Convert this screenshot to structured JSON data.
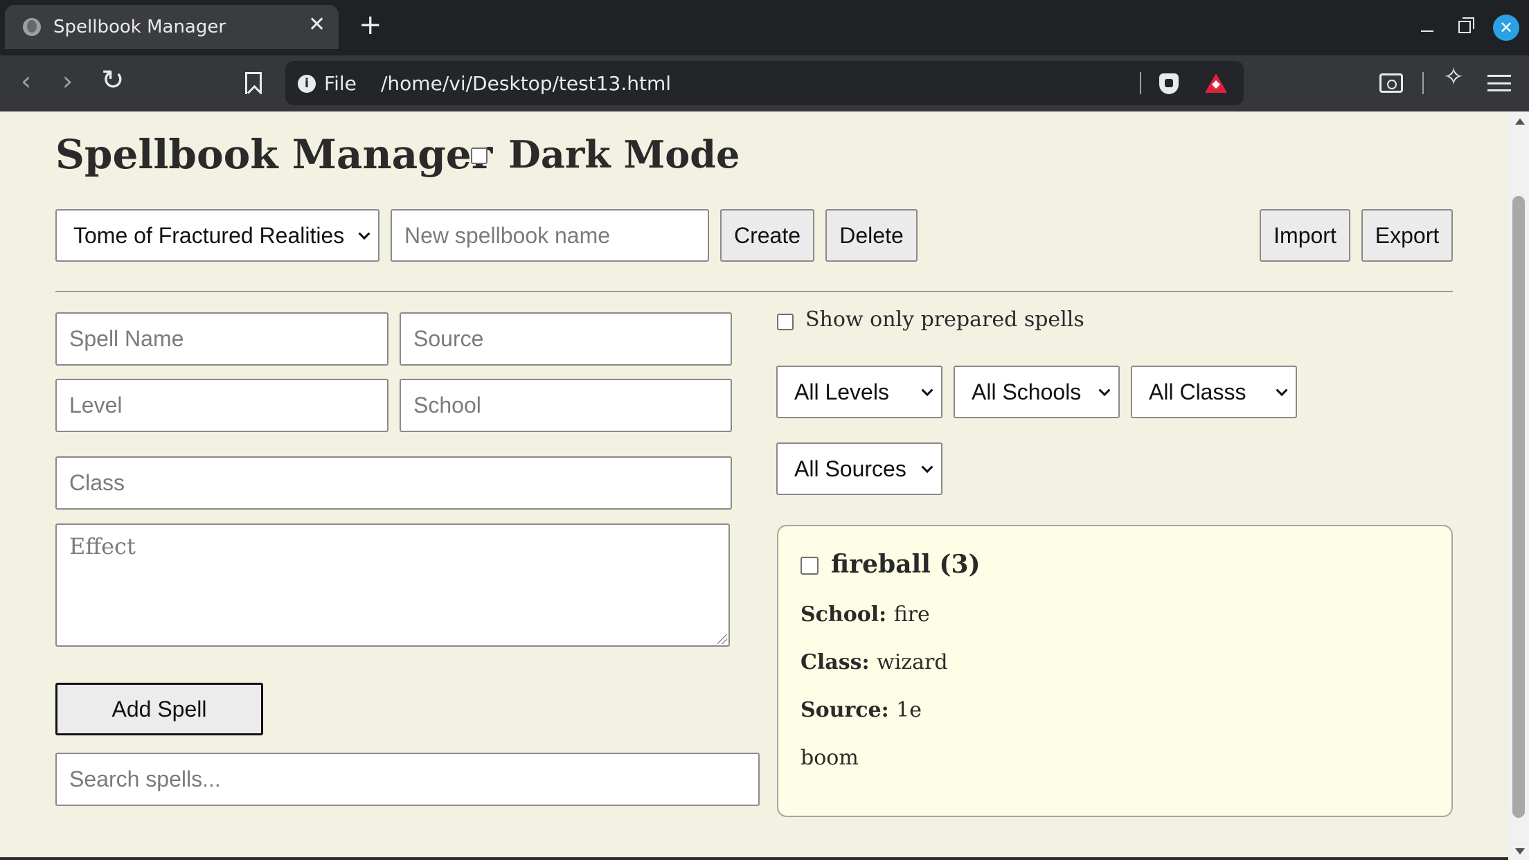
{
  "browser": {
    "tab_title": "Spellbook Manager",
    "tab_close": "✕",
    "new_tab": "+",
    "url_scheme": "File",
    "url_path": "/home/vi/Desktop/test13.html",
    "close_button": "✕",
    "back": "‹",
    "forward": "›",
    "reload": "↻",
    "ai_icon": "✧"
  },
  "app": {
    "title": "Spellbook Manager",
    "dark_mode_label": "Dark Mode",
    "dark_mode_checked": false
  },
  "spellbook_bar": {
    "selected_spellbook": "Tome of Fractured Realities",
    "new_name_placeholder": "New spellbook name",
    "create_label": "Create",
    "delete_label": "Delete",
    "import_label": "Import",
    "export_label": "Export"
  },
  "form": {
    "spell_name_placeholder": "Spell Name",
    "source_placeholder": "Source",
    "level_placeholder": "Level",
    "school_placeholder": "School",
    "class_placeholder": "Class",
    "effect_placeholder": "Effect",
    "add_label": "Add Spell",
    "search_placeholder": "Search spells..."
  },
  "filters": {
    "prepared_only_label": "Show only prepared spells",
    "prepared_only_checked": false,
    "level": "All Levels",
    "school": "All Schools",
    "class": "All Classs",
    "source": "All Sources"
  },
  "spells": [
    {
      "title": "fireball (3)",
      "school_label": "School:",
      "school": "fire",
      "class_label": "Class:",
      "class": "wizard",
      "source_label": "Source:",
      "source": "1e",
      "effect": "boom",
      "prepared": false
    }
  ],
  "colors": {
    "page_background": "#f3f1e2",
    "card_background": "#fefee6",
    "accent_close": "#2aa1e5",
    "rewards": "#e0233d"
  }
}
